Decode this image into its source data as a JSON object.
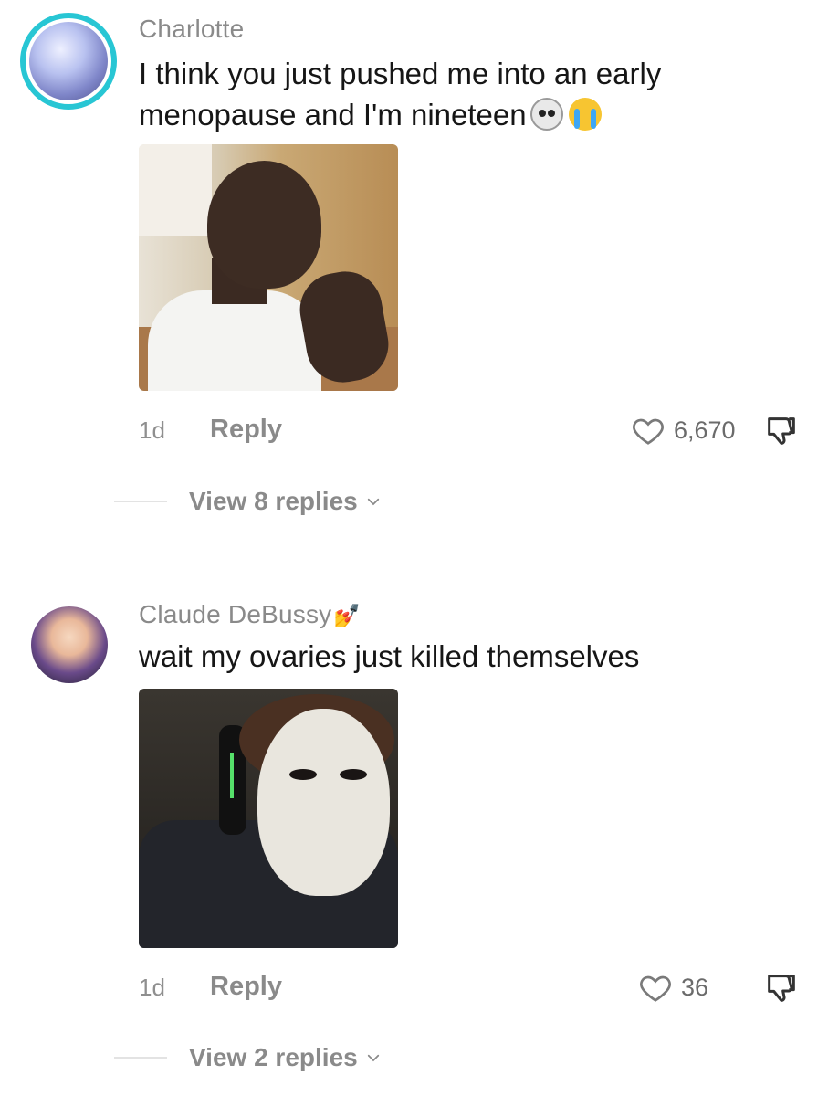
{
  "comments": [
    {
      "username": "Charlotte",
      "text": "I think you just pushed me into an early menopause and I'm nineteen",
      "emojis": [
        "skull-emoji",
        "crying-emoji"
      ],
      "age": "1d",
      "reply_label": "Reply",
      "likes": "6,670",
      "view_replies": "View 8 replies"
    },
    {
      "username": "Claude DeBussy",
      "badge": "💅",
      "text": "wait my ovaries just killed themselves",
      "age": "1d",
      "reply_label": "Reply",
      "likes": "36",
      "view_replies": "View 2 replies"
    }
  ],
  "colors": {
    "avatar_ring": "#28c6d4",
    "muted_text": "#8a8a8a",
    "body_text": "#161616"
  }
}
